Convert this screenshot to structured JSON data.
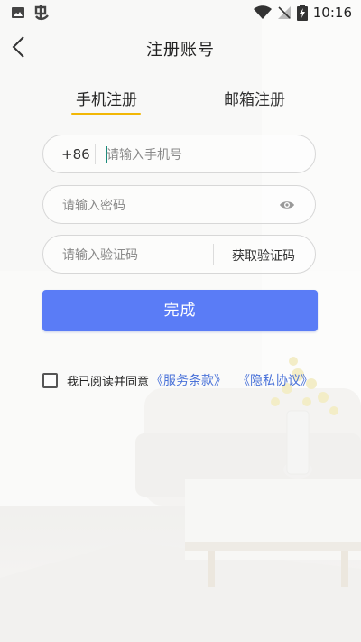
{
  "status_bar": {
    "time": "10:16",
    "left_icons": [
      "image-icon",
      "app-icon"
    ],
    "right_icons": [
      "wifi-icon",
      "no-signal-icon",
      "battery-charging-icon"
    ]
  },
  "header": {
    "title": "注册账号",
    "back_icon": "chevron-left-icon"
  },
  "tabs": [
    {
      "label": "手机注册",
      "active": true
    },
    {
      "label": "邮箱注册",
      "active": false
    }
  ],
  "form": {
    "country_code": "+86",
    "phone_placeholder": "请输入手机号",
    "password_placeholder": "请输入密码",
    "code_placeholder": "请输入验证码",
    "get_code_label": "获取验证码",
    "submit_label": "完成"
  },
  "agreement": {
    "checked": false,
    "text": "我已阅读并同意",
    "terms_link": "《服务条款》",
    "privacy_link": "《隐私协议》"
  },
  "colors": {
    "accent_underline": "#f2b705",
    "primary_button": "#5a7cf6",
    "link": "#4b73d9"
  }
}
